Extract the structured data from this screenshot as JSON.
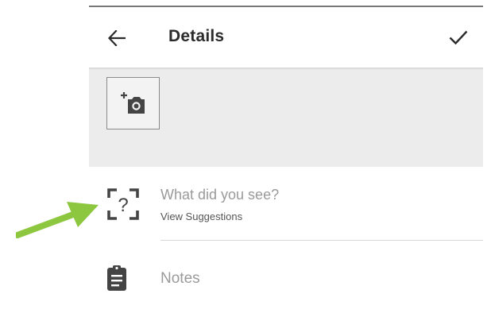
{
  "header": {
    "title": "Details",
    "back_icon": "arrow-left-icon",
    "confirm_icon": "check-icon"
  },
  "photo": {
    "icon": "add-photo-icon"
  },
  "species": {
    "icon": "species-unknown-icon",
    "placeholder": "What did you see?",
    "suggestions_label": "View Suggestions"
  },
  "notes": {
    "icon": "clipboard-icon",
    "placeholder": "Notes"
  },
  "annotation": {
    "arrow_color": "#8dc63f"
  },
  "colors": {
    "band": "#ececec",
    "text_dark": "#2b2b2b",
    "placeholder": "#9a9a9a"
  }
}
